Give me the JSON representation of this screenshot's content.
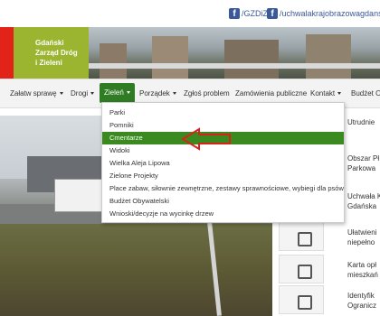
{
  "topbar": {
    "social": [
      {
        "icon": "facebook-icon",
        "label": "/GZDiZ"
      },
      {
        "icon": "facebook-icon",
        "label": "/uchwalakrajobrazowagdanska"
      }
    ]
  },
  "banner": {
    "logo_line1": "Gdański",
    "logo_line2": "Zarząd Dróg",
    "logo_line3": "i Zieleni"
  },
  "nav": {
    "items": [
      {
        "label": "Załatw sprawę",
        "dropdown": true
      },
      {
        "label": "Drogi",
        "dropdown": true
      },
      {
        "label": "Zieleń",
        "dropdown": true,
        "active": true
      },
      {
        "label": "Porządek",
        "dropdown": true
      },
      {
        "label": "Zgłoś problem",
        "dropdown": false
      },
      {
        "label": "Zamówienia publiczne",
        "dropdown": false
      },
      {
        "label": "Kontakt",
        "dropdown": true
      },
      {
        "label": "Budżet Ob",
        "dropdown": false
      }
    ]
  },
  "dropdown": {
    "items": [
      {
        "label": "Parki"
      },
      {
        "label": "Pomniki"
      },
      {
        "label": "Cmentarze",
        "highlight": true
      },
      {
        "label": "Widoki"
      },
      {
        "label": "Wielka Aleja Lipowa"
      },
      {
        "label": "Zielone Projekty"
      },
      {
        "label": "Place zabaw, siłownie zewnętrzne, zestawy sprawnościowe, wybiegi dla psów"
      },
      {
        "label": "Budżet Obywatelski"
      },
      {
        "label": "Wnioski/decyzje na wycinkę drzew"
      }
    ]
  },
  "sidebar": {
    "items": [
      {
        "line1": "Utrudnie",
        "line2": ""
      },
      {
        "line1": "Obszar Pł",
        "line2": "Parkowa"
      },
      {
        "line1": "Uchwała K",
        "line2": "Gdańska"
      },
      {
        "line1": "Ułatwieni",
        "line2": "niepełno"
      },
      {
        "line1": "Karta opł",
        "line2": "mieszkań"
      },
      {
        "line1": "Identyfik",
        "line2": "Ogranicz"
      }
    ]
  },
  "colors": {
    "brand_green": "#2f7c24",
    "brand_red": "#e2231a",
    "brand_lime": "#9cb531",
    "facebook_blue": "#3b5998",
    "annotation_arrow": "#d9231a"
  }
}
